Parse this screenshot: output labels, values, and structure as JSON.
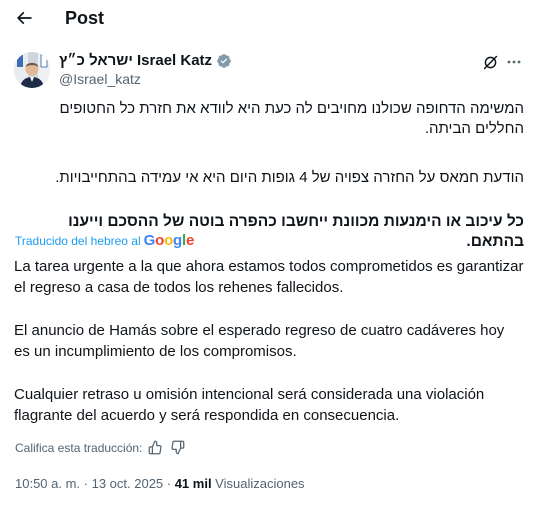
{
  "header": {
    "title": "Post"
  },
  "author": {
    "display_name": "ישראל כ״ץ Israel Katz",
    "handle": "@Israel_katz"
  },
  "post": {
    "original_paragraphs": [
      "המשימה הדחופה שכולנו מחויבים לה כעת היא לוודא את חזרת כל החטופים החללים הביתה.",
      "הודעת חמאס על החזרה צפויה של 4 גופות היום היא אי עמידה בהתחייבויות.",
      "כל עיכוב או הימנעות מכוונת ייחשבו כהפרה בוטה של ההסכם וייענו בהתאם."
    ],
    "translation_label": "Traducido del hebreo al",
    "translation_provider": "Google",
    "translated_paragraphs": [
      "La tarea urgente a la que ahora estamos todos comprometidos es garantizar el regreso a casa de todos los rehenes fallecidos.",
      "El anuncio de Hamás sobre el esperado regreso de cuatro cadáveres hoy es un incumplimiento de los compromisos.",
      "Cualquier retraso u omisión intencional será considerada una violación flagrante del acuerdo y será respondida en consecuencia."
    ],
    "rate_translation_label": "Califica esta traducción:",
    "timestamp": "10:50 a. m. · 13 oct. 2025 · ",
    "views_count": "41 mil",
    "views_label": " Visualizaciones"
  },
  "colors": {
    "accent": "#1d9bf0",
    "text_primary": "#0f1419",
    "text_secondary": "#536471"
  },
  "icons": [
    "back-arrow-icon",
    "verified-badge-icon",
    "grok-icon",
    "more-icon",
    "google-logo",
    "thumbs-up-icon",
    "thumbs-down-icon"
  ]
}
